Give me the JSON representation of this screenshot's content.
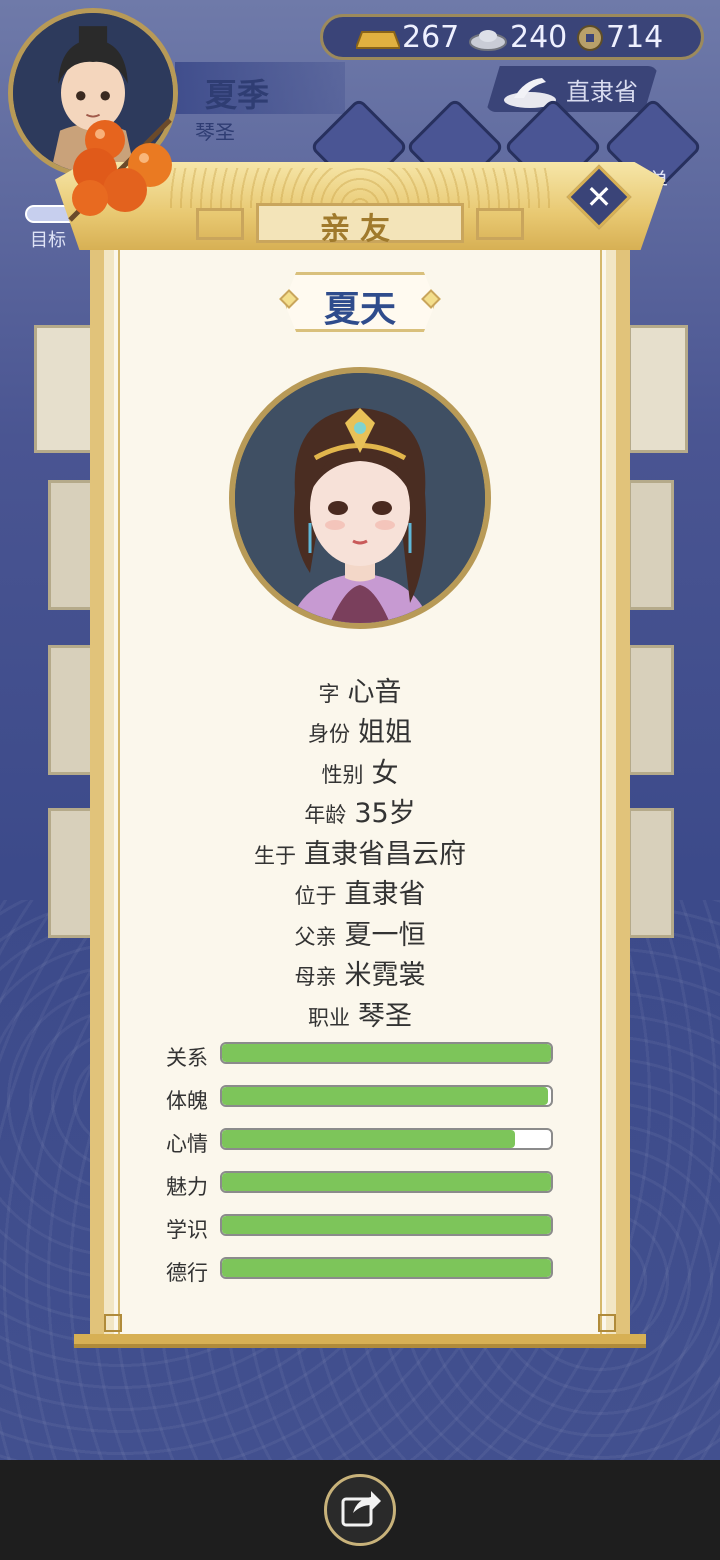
{
  "hud": {
    "player_name": "夏季",
    "player_title": "琴圣",
    "gold": "267",
    "silver": "240",
    "coins": "714",
    "province": "直隶省",
    "goal_label": "目标",
    "menu_fragment": "单"
  },
  "modal": {
    "title": "亲友",
    "close_icon": "close-icon",
    "person_name": "夏天",
    "info": [
      {
        "key": "字",
        "value": "心音"
      },
      {
        "key": "身份",
        "value": "姐姐"
      },
      {
        "key": "性别",
        "value": "女"
      },
      {
        "key": "年龄",
        "value": "35岁"
      },
      {
        "key": "生于",
        "value": "直隶省昌云府"
      },
      {
        "key": "位于",
        "value": "直隶省"
      },
      {
        "key": "父亲",
        "value": "夏一恒"
      },
      {
        "key": "母亲",
        "value": "米霓裳"
      },
      {
        "key": "职业",
        "value": "琴圣"
      }
    ],
    "stats": [
      {
        "label": "关系",
        "fraction": 1.0
      },
      {
        "label": "体魄",
        "fraction": 0.99
      },
      {
        "label": "心情",
        "fraction": 0.89
      },
      {
        "label": "魅力",
        "fraction": 1.0
      },
      {
        "label": "学识",
        "fraction": 1.0
      },
      {
        "label": "德行",
        "fraction": 1.0
      }
    ]
  },
  "colors": {
    "stat_fill": "#7dc55a",
    "name_text": "#2f4c8c",
    "title_gold": "#a07a2c"
  },
  "bottom": {
    "share_icon": "share-icon"
  }
}
